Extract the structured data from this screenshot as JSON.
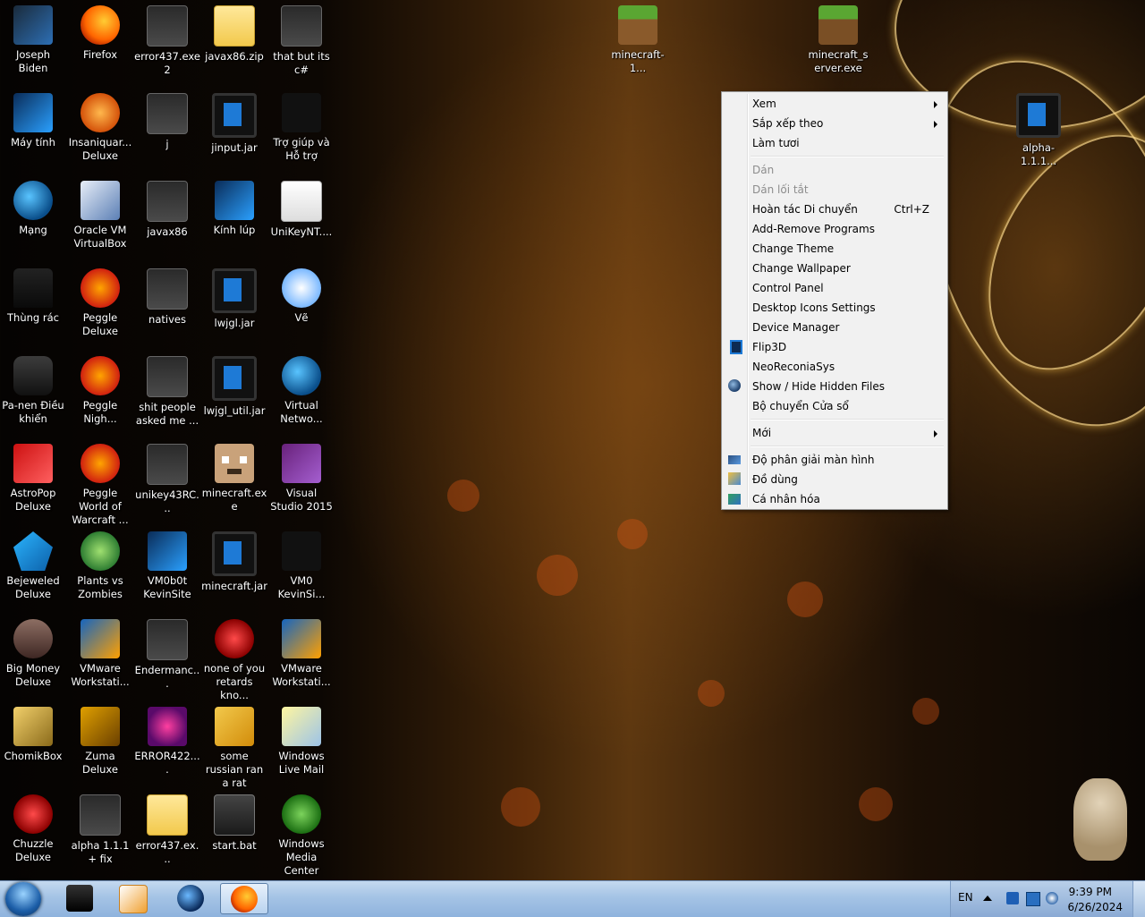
{
  "desktop_icons": [
    {
      "label": "Joseph Biden",
      "icon": "computer-icon"
    },
    {
      "label": "Firefox",
      "icon": "firefox-icon"
    },
    {
      "label": "error437.exe2",
      "icon": "file-icon"
    },
    {
      "label": "javax86.zip",
      "icon": "zip-icon"
    },
    {
      "label": "that but its c#",
      "icon": "file-icon"
    },
    {
      "label": "Máy tính",
      "icon": "monitor-icon"
    },
    {
      "label": "Insaniquar... Deluxe",
      "icon": "bird-icon"
    },
    {
      "label": "j",
      "icon": "file-icon"
    },
    {
      "label": "jinput.jar",
      "icon": "jar-icon"
    },
    {
      "label": "Trợ giúp và Hỗ trợ",
      "icon": "help-icon"
    },
    {
      "label": "Mạng",
      "icon": "network-icon"
    },
    {
      "label": "Oracle VM VirtualBox",
      "icon": "virtualbox-icon"
    },
    {
      "label": "javax86",
      "icon": "file-icon"
    },
    {
      "label": "Kính lúp",
      "icon": "magnifier-icon"
    },
    {
      "label": "UniKeyNT....",
      "icon": "unikey-icon"
    },
    {
      "label": "Thùng rác",
      "icon": "recycle-bin-icon"
    },
    {
      "label": "Peggle Deluxe",
      "icon": "peggle-icon"
    },
    {
      "label": "natives",
      "icon": "file-icon"
    },
    {
      "label": "lwjgl.jar",
      "icon": "jar-icon"
    },
    {
      "label": "Vẽ",
      "icon": "paint-icon"
    },
    {
      "label": "Pa-nen Điều khiển",
      "icon": "control-panel-icon"
    },
    {
      "label": "Peggle Nigh...",
      "icon": "peggle-icon"
    },
    {
      "label": "shit people asked me ...",
      "icon": "file-icon"
    },
    {
      "label": "lwjgl_util.jar",
      "icon": "jar-icon"
    },
    {
      "label": "Virtual Netwo...",
      "icon": "globe-icon"
    },
    {
      "label": "AstroPop Deluxe",
      "icon": "astropop-icon"
    },
    {
      "label": "Peggle World of Warcraft ...",
      "icon": "peggle-icon"
    },
    {
      "label": "unikey43RC...",
      "icon": "file-icon"
    },
    {
      "label": "minecraft.exe",
      "icon": "minecraft-face-icon"
    },
    {
      "label": "Visual Studio 2015",
      "icon": "visual-studio-icon"
    },
    {
      "label": "Bejeweled Deluxe",
      "icon": "gem-icon"
    },
    {
      "label": "Plants vs Zombies",
      "icon": "plant-icon"
    },
    {
      "label": "VM0b0t KevinSite",
      "icon": "monitor-icon"
    },
    {
      "label": "minecraft.jar",
      "icon": "jar-icon"
    },
    {
      "label": "VM0 KevinSi...",
      "icon": "file-icon"
    },
    {
      "label": "Big Money Deluxe",
      "icon": "money-icon"
    },
    {
      "label": "VMware Workstati...",
      "icon": "vmware-icon"
    },
    {
      "label": "Endermanc...",
      "icon": "file-icon"
    },
    {
      "label": "none of you retards kno...",
      "icon": "chuzzle-icon"
    },
    {
      "label": "VMware Workstati...",
      "icon": "vmware-icon"
    },
    {
      "label": "ChomikBox",
      "icon": "chomikbox-icon"
    },
    {
      "label": "Zuma Deluxe",
      "icon": "zuma-icon"
    },
    {
      "label": "ERROR422....",
      "icon": "error-icon"
    },
    {
      "label": "some russian ran a rat",
      "icon": "rat-icon"
    },
    {
      "label": "Windows Live Mail",
      "icon": "mail-icon"
    },
    {
      "label": "Chuzzle Deluxe",
      "icon": "chuzzle-icon"
    },
    {
      "label": "alpha 1.1.1 + fix",
      "icon": "file-icon"
    },
    {
      "label": "error437.ex...",
      "icon": "zip-icon"
    },
    {
      "label": "start.bat",
      "icon": "batch-file-icon"
    },
    {
      "label": "Windows Media Center",
      "icon": "media-center-icon"
    }
  ],
  "right_icons": [
    {
      "label": "minecraft-1...",
      "icon": "minecraft-block-icon"
    },
    {
      "label": "minecraft_server.exe",
      "icon": "minecraft-block-icon"
    },
    {
      "label": "alpha-1.1.1...",
      "icon": "jar-icon"
    }
  ],
  "context_menu": {
    "view": "Xem",
    "sort_by": "Sắp xếp theo",
    "refresh": "Làm tươi",
    "paste": "Dán",
    "paste_shortcut": "Dán lối tắt",
    "undo_move": "Hoàn tác Di chuyển",
    "undo_shortcut": "Ctrl+Z",
    "add_remove": "Add-Remove Programs",
    "change_theme": "Change Theme",
    "change_wallpaper": "Change Wallpaper",
    "control_panel": "Control Panel",
    "desktop_icons_settings": "Desktop Icons Settings",
    "device_manager": "Device Manager",
    "flip3d": "Flip3D",
    "neoreconia": "NeoReconiaSys",
    "show_hide": "Show / Hide Hidden Files",
    "window_switcher": "Bộ chuyển Cửa sổ",
    "new": "Mới",
    "resolution": "Độ phân giải màn hình",
    "gadgets": "Đồ dùng",
    "personalize": "Cá nhân hóa"
  },
  "taskbar": {
    "language": "EN",
    "time": "9:39 PM",
    "date": "6/26/2024"
  },
  "colors": {
    "taskbar": "#a4c3e5",
    "menu_bg": "#f1f1f1",
    "menu_disabled": "#8d8d8d"
  }
}
